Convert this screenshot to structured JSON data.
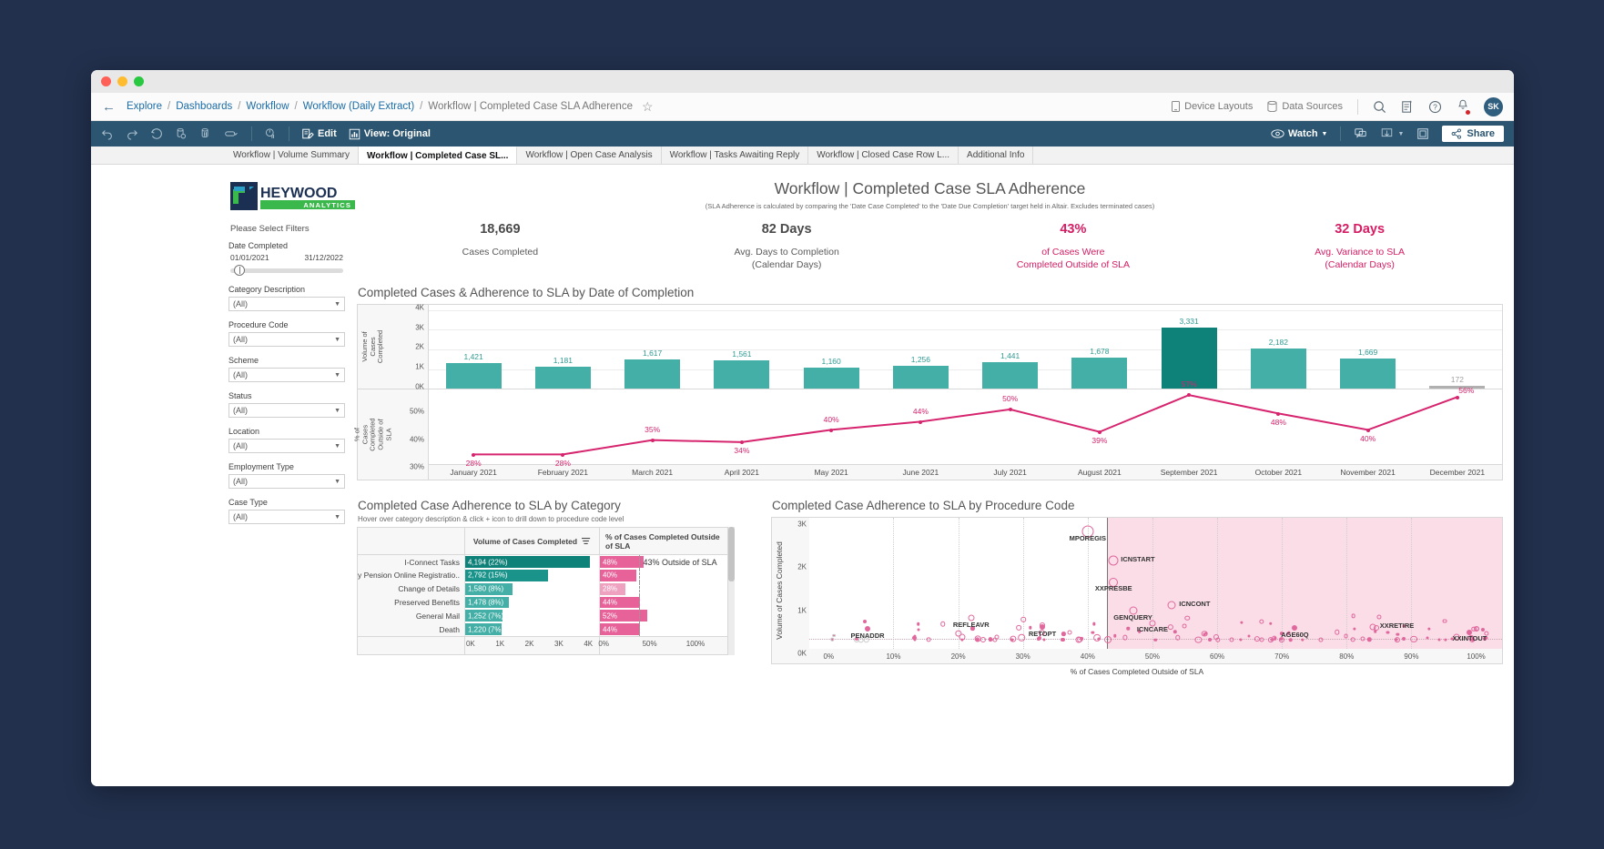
{
  "window": {
    "traffic_lights": [
      "close",
      "minimize",
      "maximize"
    ]
  },
  "breadcrumb": {
    "back_icon": "back-arrow-icon",
    "items": [
      "Explore",
      "Dashboards",
      "Workflow",
      "Workflow (Daily Extract)"
    ],
    "current": "Workflow | Completed Case SLA Adherence",
    "favorite_icon": "star-icon",
    "device_layouts": "Device Layouts",
    "data_sources": "Data Sources",
    "search_icon": "search-icon",
    "new_icon": "new-content-icon",
    "help_icon": "help-icon",
    "alerts_icon": "bell-icon",
    "avatar_initials": "SK"
  },
  "toolbar": {
    "undo_icon": "undo-icon",
    "redo_icon": "redo-icon",
    "revert_icon": "revert-icon",
    "refresh_icon": "refresh-data-icon",
    "pause_icon": "pause-data-icon",
    "view_icon": "custom-view-icon",
    "alert_icon": "alert-icon",
    "edit_label": "Edit",
    "view_label": "View: Original",
    "watch_label": "Watch",
    "comment_icon": "comment-icon",
    "download_icon": "download-icon",
    "fullscreen_icon": "fullscreen-icon",
    "share_label": "Share"
  },
  "tabs": [
    {
      "label": "Workflow | Volume Summary",
      "active": false
    },
    {
      "label": "Workflow | Completed Case SL...",
      "active": true
    },
    {
      "label": "Workflow | Open Case Analysis",
      "active": false
    },
    {
      "label": "Workflow | Tasks Awaiting Reply",
      "active": false
    },
    {
      "label": "Workflow | Closed Case Row L...",
      "active": false
    },
    {
      "label": "Additional Info",
      "active": false
    }
  ],
  "logo": {
    "name": "HEYWOOD",
    "sub": "ANALYTICS"
  },
  "filters": {
    "heading": "Please Select Filters",
    "date": {
      "label": "Date Completed",
      "start": "01/01/2021",
      "end": "31/12/2022"
    },
    "dropdowns": [
      {
        "label": "Category Description",
        "value": "(All)"
      },
      {
        "label": "Procedure Code",
        "value": "(All)"
      },
      {
        "label": "Scheme",
        "value": "(All)"
      },
      {
        "label": "Status",
        "value": "(All)"
      },
      {
        "label": "Location",
        "value": "(All)"
      },
      {
        "label": "Employment Type",
        "value": "(All)"
      },
      {
        "label": "Case Type",
        "value": "(All)"
      }
    ]
  },
  "header": {
    "title": "Workflow | Completed Case SLA Adherence",
    "subtitle": "(SLA Adherence is calculated by comparing the 'Date Case Completed' to the 'Date Due Completion' target held in Altair. Excludes terminated cases)"
  },
  "kpis": [
    {
      "value": "18,669",
      "label": "Cases Completed",
      "accent": false
    },
    {
      "value": "82 Days",
      "label": "Avg. Days to Completion\n(Calendar Days)",
      "accent": false
    },
    {
      "value": "43%",
      "label": "of Cases Were\nCompleted Outside of SLA",
      "accent": true
    },
    {
      "value": "32 Days",
      "label": "Avg. Variance to SLA\n(Calendar Days)",
      "accent": true
    }
  ],
  "sections": {
    "combo_title": "Completed Cases & Adherence to SLA by Date of Completion",
    "category_title": "Completed Case Adherence to SLA by Category",
    "category_subtitle": "Hover over category description & click + icon to drill down to procedure code level",
    "procedure_title": "Completed Case Adherence to SLA by Procedure Code"
  },
  "colors": {
    "teal": "#43afa6",
    "teal_dark": "#0e8178",
    "pink": "#e8629a",
    "pink_line": "#d6246e",
    "accent_text": "#d61c63",
    "grey_bar": "#b0b0b0"
  },
  "chart_data": [
    {
      "type": "bar",
      "id": "completed-cases-sla-by-date",
      "title": "Completed Cases & Adherence to SLA by Date of Completion",
      "categories": [
        "January 2021",
        "February 2021",
        "March 2021",
        "April 2021",
        "May 2021",
        "June 2021",
        "July 2021",
        "August 2021",
        "September 2021",
        "October 2021",
        "November 2021",
        "December 2021"
      ],
      "series": [
        {
          "name": "Volume of Cases Completed",
          "axis": "left",
          "values": [
            1421,
            1181,
            1617,
            1561,
            1160,
            1256,
            1441,
            1678,
            3331,
            2182,
            1669,
            172
          ],
          "labels": [
            "1,421",
            "1,181",
            "1,617",
            "1,561",
            "1,160",
            "1,256",
            "1,441",
            "1,678",
            "3,331",
            "2,182",
            "1,669",
            "172"
          ]
        },
        {
          "name": "% of Cases Completed Outside of SLA",
          "axis": "right",
          "type": "line",
          "values": [
            28,
            28,
            35,
            34,
            40,
            44,
            50,
            39,
            57,
            48,
            40,
            56
          ],
          "labels": [
            "28%",
            "28%",
            "35%",
            "34%",
            "40%",
            "44%",
            "50%",
            "39%",
            "57%",
            "48%",
            "40%",
            "56%"
          ]
        }
      ],
      "ylabel": "Volume of Cases Completed",
      "y2label": "% of Cases Completed Outside of SLA",
      "yticks": [
        "0K",
        "1K",
        "2K",
        "3K",
        "4K"
      ],
      "y2ticks": [
        "30%",
        "40%",
        "50%"
      ],
      "ylim": [
        0,
        4000
      ],
      "y2lim": [
        25,
        58
      ],
      "grid": true
    },
    {
      "type": "bar",
      "id": "adherence-by-category",
      "title": "Completed Case Adherence to SLA by Category",
      "subtitle": "Hover over category description & click + icon to drill down to procedure code level",
      "columns": [
        "",
        "Volume of Cases Completed",
        "% of Cases Completed Outside of SLA"
      ],
      "categories": [
        "I-Connect Tasks",
        "My Pension Online Registratio..",
        "Change of Details",
        "Preserved Benefits",
        "General Mail",
        "Death"
      ],
      "volume_values": [
        4194,
        2792,
        1580,
        1478,
        1252,
        1220
      ],
      "volume_labels": [
        "4,194 (22%)",
        "2,792 (15%)",
        "1,580 (8%)",
        "1,478 (8%)",
        "1,252 (7%)",
        "1,220 (7%)"
      ],
      "pct_values": [
        48,
        40,
        28,
        44,
        52,
        44
      ],
      "pct_labels": [
        "48%",
        "40%",
        "28%",
        "44%",
        "52%",
        "44%"
      ],
      "reference_line": {
        "value": 43,
        "label": "43% Outside of SLA"
      },
      "xticks_volume": [
        "0K",
        "1K",
        "2K",
        "3K",
        "4K"
      ],
      "xticks_pct": [
        "0%",
        "50%",
        "100%"
      ],
      "xlim_volume": [
        0,
        4500
      ],
      "xlim_pct": [
        0,
        100
      ]
    },
    {
      "type": "scatter",
      "id": "adherence-by-procedure-code",
      "title": "Completed Case Adherence to SLA by Procedure Code",
      "xlabel": "% of Cases Completed Outside of SLA",
      "ylabel": "Volume of Cases Completed",
      "xticks": [
        "0%",
        "10%",
        "20%",
        "30%",
        "40%",
        "50%",
        "60%",
        "70%",
        "80%",
        "90%",
        "100%"
      ],
      "yticks": [
        "0K",
        "1K",
        "2K",
        "3K"
      ],
      "xlim": [
        -3,
        104
      ],
      "ylim": [
        0,
        3000
      ],
      "reference_line_x": 43,
      "shaded_region": "x > 43% highlighted pink",
      "labeled_points": [
        {
          "label": "MPOREGIS",
          "x": 40,
          "y": 2790,
          "size": 13
        },
        {
          "label": "ICNSTART",
          "x": 44,
          "y": 2050,
          "size": 11
        },
        {
          "label": "XXPRESBE",
          "x": 44,
          "y": 1490,
          "size": 10
        },
        {
          "label": "ICNCONT",
          "x": 53,
          "y": 900,
          "size": 9
        },
        {
          "label": "GENQUERY",
          "x": 47,
          "y": 750,
          "size": 9
        },
        {
          "label": "REFLEAVR",
          "x": 22,
          "y": 560,
          "size": 7
        },
        {
          "label": "PENADDR",
          "x": 6,
          "y": 280,
          "size": 6
        },
        {
          "label": "RETOPT",
          "x": 33,
          "y": 330,
          "size": 6
        },
        {
          "label": "ICNCARE",
          "x": 50,
          "y": 430,
          "size": 7
        },
        {
          "label": "AGE60Q",
          "x": 72,
          "y": 300,
          "size": 6
        },
        {
          "label": "XXRETIRE",
          "x": 84,
          "y": 340,
          "size": 7
        },
        {
          "label": "XXINTOUT",
          "x": 99,
          "y": 200,
          "size": 6
        }
      ]
    }
  ]
}
